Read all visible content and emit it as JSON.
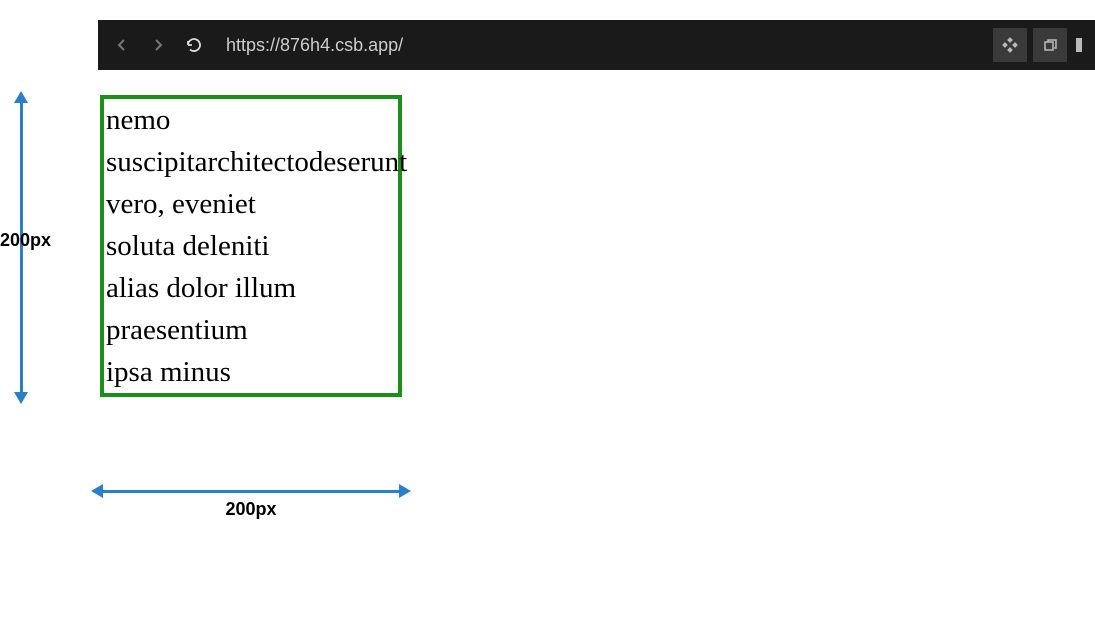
{
  "browser": {
    "url": "https://876h4.csb.app/"
  },
  "box": {
    "items": [
      "nemo",
      "suscipitarchitectodeserunt",
      "vero, eveniet",
      "soluta deleniti",
      "alias dolor illum",
      "praesentium",
      "ipsa minus"
    ]
  },
  "dimensions": {
    "height_label": "200px",
    "width_label": "200px"
  }
}
